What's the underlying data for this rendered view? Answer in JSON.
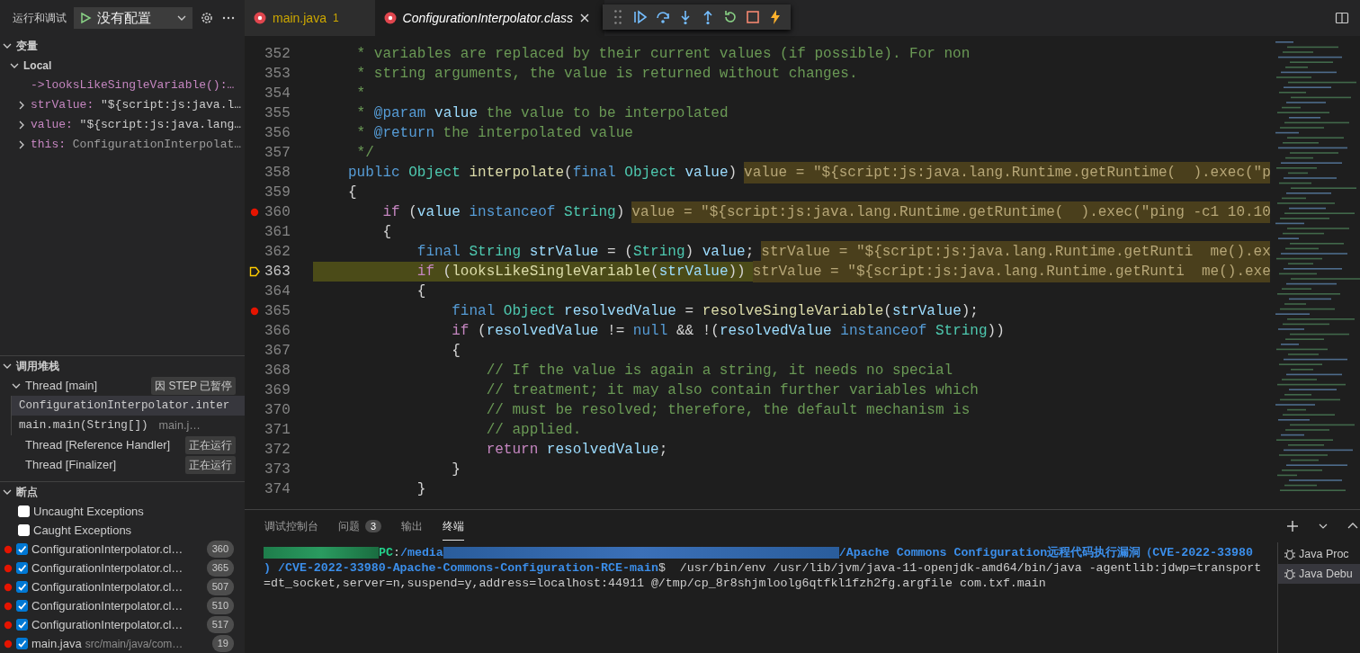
{
  "sidebar": {
    "title": "运行和调试",
    "config": "没有配置",
    "variables": {
      "title": "变量",
      "expanded": true,
      "scope": {
        "label": "Local",
        "expanded": true
      },
      "items": [
        {
          "kind": "return",
          "name": "->looksLikeSingleVariable():…"
        },
        {
          "kind": "string",
          "name": "strValue:",
          "value": "\"${script:js:java.l…",
          "expanded": false
        },
        {
          "kind": "string",
          "name": "value:",
          "value": "\"${script:js:java.lang…",
          "expanded": false
        },
        {
          "kind": "object",
          "name": "this:",
          "value": "ConfigurationInterpolat…",
          "expanded": false
        }
      ]
    },
    "call_stack": {
      "title": "调用堆栈",
      "expanded": true,
      "threads": [
        {
          "label": "Thread [main]",
          "status": "因 STEP 已暂停",
          "expanded": true,
          "frames": [
            {
              "label": "ConfigurationInterpolator.inter",
              "selected": true
            },
            {
              "label": "main.main(String[])",
              "source": "main.j…",
              "selected": false
            }
          ]
        },
        {
          "label": "Thread [Reference Handler]",
          "status": "正在运行"
        },
        {
          "label": "Thread [Finalizer]",
          "status": "正在运行"
        }
      ]
    },
    "breakpoints": {
      "title": "断点",
      "expanded": true,
      "items": [
        {
          "kind": "exception",
          "label": "Uncaught Exceptions",
          "checked": false
        },
        {
          "kind": "exception",
          "label": "Caught Exceptions",
          "checked": false
        },
        {
          "kind": "line",
          "label": "ConfigurationInterpolator.cl…",
          "line": "360",
          "checked": true
        },
        {
          "kind": "line",
          "label": "ConfigurationInterpolator.cl…",
          "line": "365",
          "checked": true
        },
        {
          "kind": "line",
          "label": "ConfigurationInterpolator.cl…",
          "line": "507",
          "checked": true
        },
        {
          "kind": "line",
          "label": "ConfigurationInterpolator.cl…",
          "line": "510",
          "checked": true
        },
        {
          "kind": "line",
          "label": "ConfigurationInterpolator.cl…",
          "line": "517",
          "checked": true
        },
        {
          "kind": "line",
          "label": "main.java",
          "path": "src/main/java/com…",
          "line": "19",
          "checked": true
        }
      ]
    }
  },
  "editor": {
    "tabs": [
      {
        "label": "main.java",
        "problems": "1",
        "selected": false,
        "preview": false
      },
      {
        "label": "ConfigurationInterpolator.class",
        "selected": true,
        "preview": true
      }
    ],
    "lines": [
      {
        "number": "352",
        "breakpoint": false,
        "current": false,
        "tokens": [
          {
            "kind": "cmt",
            "text": " * variables are replaced by their current values (if possible). For non"
          }
        ]
      },
      {
        "number": "353",
        "breakpoint": false,
        "current": false,
        "tokens": [
          {
            "kind": "cmt",
            "text": " * string arguments, the value is returned without changes."
          }
        ]
      },
      {
        "number": "354",
        "breakpoint": false,
        "current": false,
        "tokens": [
          {
            "kind": "cmt",
            "text": " *"
          }
        ]
      },
      {
        "number": "355",
        "breakpoint": false,
        "current": false,
        "tokens": [
          {
            "kind": "cmt",
            "text": " *"
          },
          {
            "kind": "tag",
            "text": " @param"
          },
          {
            "kind": "var",
            "text": " value"
          },
          {
            "kind": "cmt",
            "text": " the value to be interpolated"
          }
        ]
      },
      {
        "number": "356",
        "breakpoint": false,
        "current": false,
        "tokens": [
          {
            "kind": "cmt",
            "text": " *"
          },
          {
            "kind": "tag",
            "text": " @return"
          },
          {
            "kind": "cmt",
            "text": " the interpolated value"
          }
        ]
      },
      {
        "number": "357",
        "breakpoint": false,
        "current": false,
        "tokens": [
          {
            "kind": "cmt",
            "text": " */"
          }
        ]
      },
      {
        "number": "358",
        "breakpoint": false,
        "current": false,
        "tokens": [
          {
            "kind": "kw",
            "text": "public"
          },
          {
            "kind": "type",
            "text": " Object"
          },
          {
            "kind": "fn",
            "text": " interpolate"
          },
          {
            "kind": "p",
            "text": "("
          },
          {
            "kind": "kw",
            "text": "final"
          },
          {
            "kind": "type",
            "text": " Object"
          },
          {
            "kind": "var",
            "text": " value"
          },
          {
            "kind": "p",
            "text": ")"
          }
        ],
        "hint": "value = \"${script:js:java.lang.Runtime.getRuntime(  ).exec(\"p"
      },
      {
        "number": "359",
        "breakpoint": false,
        "current": false,
        "tokens": [
          {
            "kind": "p",
            "text": "{"
          }
        ]
      },
      {
        "number": "360",
        "breakpoint": true,
        "current": false,
        "tokens": [
          {
            "kind": "ctl",
            "text": "    if"
          },
          {
            "kind": "p",
            "text": " ("
          },
          {
            "kind": "var",
            "text": "value"
          },
          {
            "kind": "kw",
            "text": " instanceof"
          },
          {
            "kind": "type",
            "text": " String"
          },
          {
            "kind": "p",
            "text": ")"
          }
        ],
        "hint": "value = \"${script:js:java.lang.Runtime.getRuntime(  ).exec(\"ping -c1 10.10"
      },
      {
        "number": "361",
        "breakpoint": false,
        "current": false,
        "tokens": [
          {
            "kind": "p",
            "text": "    {"
          }
        ]
      },
      {
        "number": "362",
        "breakpoint": false,
        "current": false,
        "tokens": [
          {
            "kind": "kw",
            "text": "        final"
          },
          {
            "kind": "type",
            "text": " String"
          },
          {
            "kind": "var",
            "text": " strValue"
          },
          {
            "kind": "p",
            "text": " = ("
          },
          {
            "kind": "type",
            "text": "String"
          },
          {
            "kind": "p",
            "text": ")"
          },
          {
            "kind": "var",
            "text": " value"
          },
          {
            "kind": "p",
            "text": ";"
          }
        ],
        "hint": "strValue = \"${script:js:java.lang.Runtime.getRunti  me().ex"
      },
      {
        "number": "363",
        "breakpoint": false,
        "current": true,
        "tokens": [
          {
            "kind": "ctl",
            "text": "        if"
          },
          {
            "kind": "p",
            "text": " ("
          },
          {
            "kind": "fn",
            "text": "looksLikeSingleVariable"
          },
          {
            "kind": "p",
            "text": "("
          },
          {
            "kind": "var",
            "text": "strValue"
          },
          {
            "kind": "p",
            "text": "))"
          }
        ],
        "hint": "strValue = \"${script:js:java.lang.Runtime.getRunti  me().exe"
      },
      {
        "number": "364",
        "breakpoint": false,
        "current": false,
        "tokens": [
          {
            "kind": "p",
            "text": "        {"
          }
        ]
      },
      {
        "number": "365",
        "breakpoint": true,
        "current": false,
        "tokens": [
          {
            "kind": "kw",
            "text": "            final"
          },
          {
            "kind": "type",
            "text": " Object"
          },
          {
            "kind": "var",
            "text": " resolvedValue"
          },
          {
            "kind": "p",
            "text": " ="
          },
          {
            "kind": "fn",
            "text": " resolveSingleVariable"
          },
          {
            "kind": "p",
            "text": "("
          },
          {
            "kind": "var",
            "text": "strValue"
          },
          {
            "kind": "p",
            "text": ");"
          }
        ]
      },
      {
        "number": "366",
        "breakpoint": false,
        "current": false,
        "tokens": [
          {
            "kind": "ctl",
            "text": "            if"
          },
          {
            "kind": "p",
            "text": " ("
          },
          {
            "kind": "var",
            "text": "resolvedValue"
          },
          {
            "kind": "p",
            "text": " !="
          },
          {
            "kind": "kw",
            "text": " null"
          },
          {
            "kind": "p",
            "text": " && !("
          },
          {
            "kind": "var",
            "text": "resolvedValue"
          },
          {
            "kind": "kw",
            "text": " instanceof"
          },
          {
            "kind": "type",
            "text": " String"
          },
          {
            "kind": "p",
            "text": "))"
          }
        ]
      },
      {
        "number": "367",
        "breakpoint": false,
        "current": false,
        "tokens": [
          {
            "kind": "p",
            "text": "            {"
          }
        ]
      },
      {
        "number": "368",
        "breakpoint": false,
        "current": false,
        "tokens": [
          {
            "kind": "cmt",
            "text": "                // If the value is again a string, it needs no special"
          }
        ]
      },
      {
        "number": "369",
        "breakpoint": false,
        "current": false,
        "tokens": [
          {
            "kind": "cmt",
            "text": "                // treatment; it may also contain further variables which"
          }
        ]
      },
      {
        "number": "370",
        "breakpoint": false,
        "current": false,
        "tokens": [
          {
            "kind": "cmt",
            "text": "                // must be resolved; therefore, the default mechanism is"
          }
        ]
      },
      {
        "number": "371",
        "breakpoint": false,
        "current": false,
        "tokens": [
          {
            "kind": "cmt",
            "text": "                // applied."
          }
        ]
      },
      {
        "number": "372",
        "breakpoint": false,
        "current": false,
        "tokens": [
          {
            "kind": "ctl",
            "text": "                return"
          },
          {
            "kind": "var",
            "text": " resolvedValue"
          },
          {
            "kind": "p",
            "text": ";"
          }
        ]
      },
      {
        "number": "373",
        "breakpoint": false,
        "current": false,
        "tokens": [
          {
            "kind": "p",
            "text": "            }"
          }
        ]
      },
      {
        "number": "374",
        "breakpoint": false,
        "current": false,
        "tokens": [
          {
            "kind": "p",
            "text": "        }"
          }
        ]
      }
    ]
  },
  "panel": {
    "tabs": [
      {
        "label": "调试控制台",
        "selected": false
      },
      {
        "label": "问题",
        "badge": "3",
        "selected": false
      },
      {
        "label": "输出",
        "selected": false
      },
      {
        "label": "终端",
        "selected": true
      }
    ],
    "terminal_lines": [
      [
        {
          "kind": "mask-user"
        },
        {
          "kind": "user",
          "text": "PC"
        },
        {
          "kind": "plain",
          "text": ":"
        },
        {
          "kind": "path",
          "text": "/media"
        },
        {
          "kind": "mask-path"
        },
        {
          "kind": "path",
          "text": "/Apache Commons Configuration远程代码执行漏洞（CVE-2022-33980"
        }
      ],
      [
        {
          "kind": "path",
          "text": ") /CVE-2022-33980-Apache-Commons-Configuration-RCE-main"
        },
        {
          "kind": "plain",
          "text": "$  /usr/bin/env /usr/lib/jvm/java-11-openjdk-amd64/bin/java -agentlib:jdwp=transport"
        }
      ],
      [
        {
          "kind": "plain",
          "text": "=dt_socket,server=n,suspend=y,address=localhost:44911 @/tmp/cp_8r8shjmloolg6qtfkl1fzh2fg.argfile com.txf.main"
        }
      ]
    ],
    "sessions": [
      {
        "label": "Java Proc",
        "selected": false
      },
      {
        "label": "Java Debu",
        "selected": true
      }
    ]
  }
}
